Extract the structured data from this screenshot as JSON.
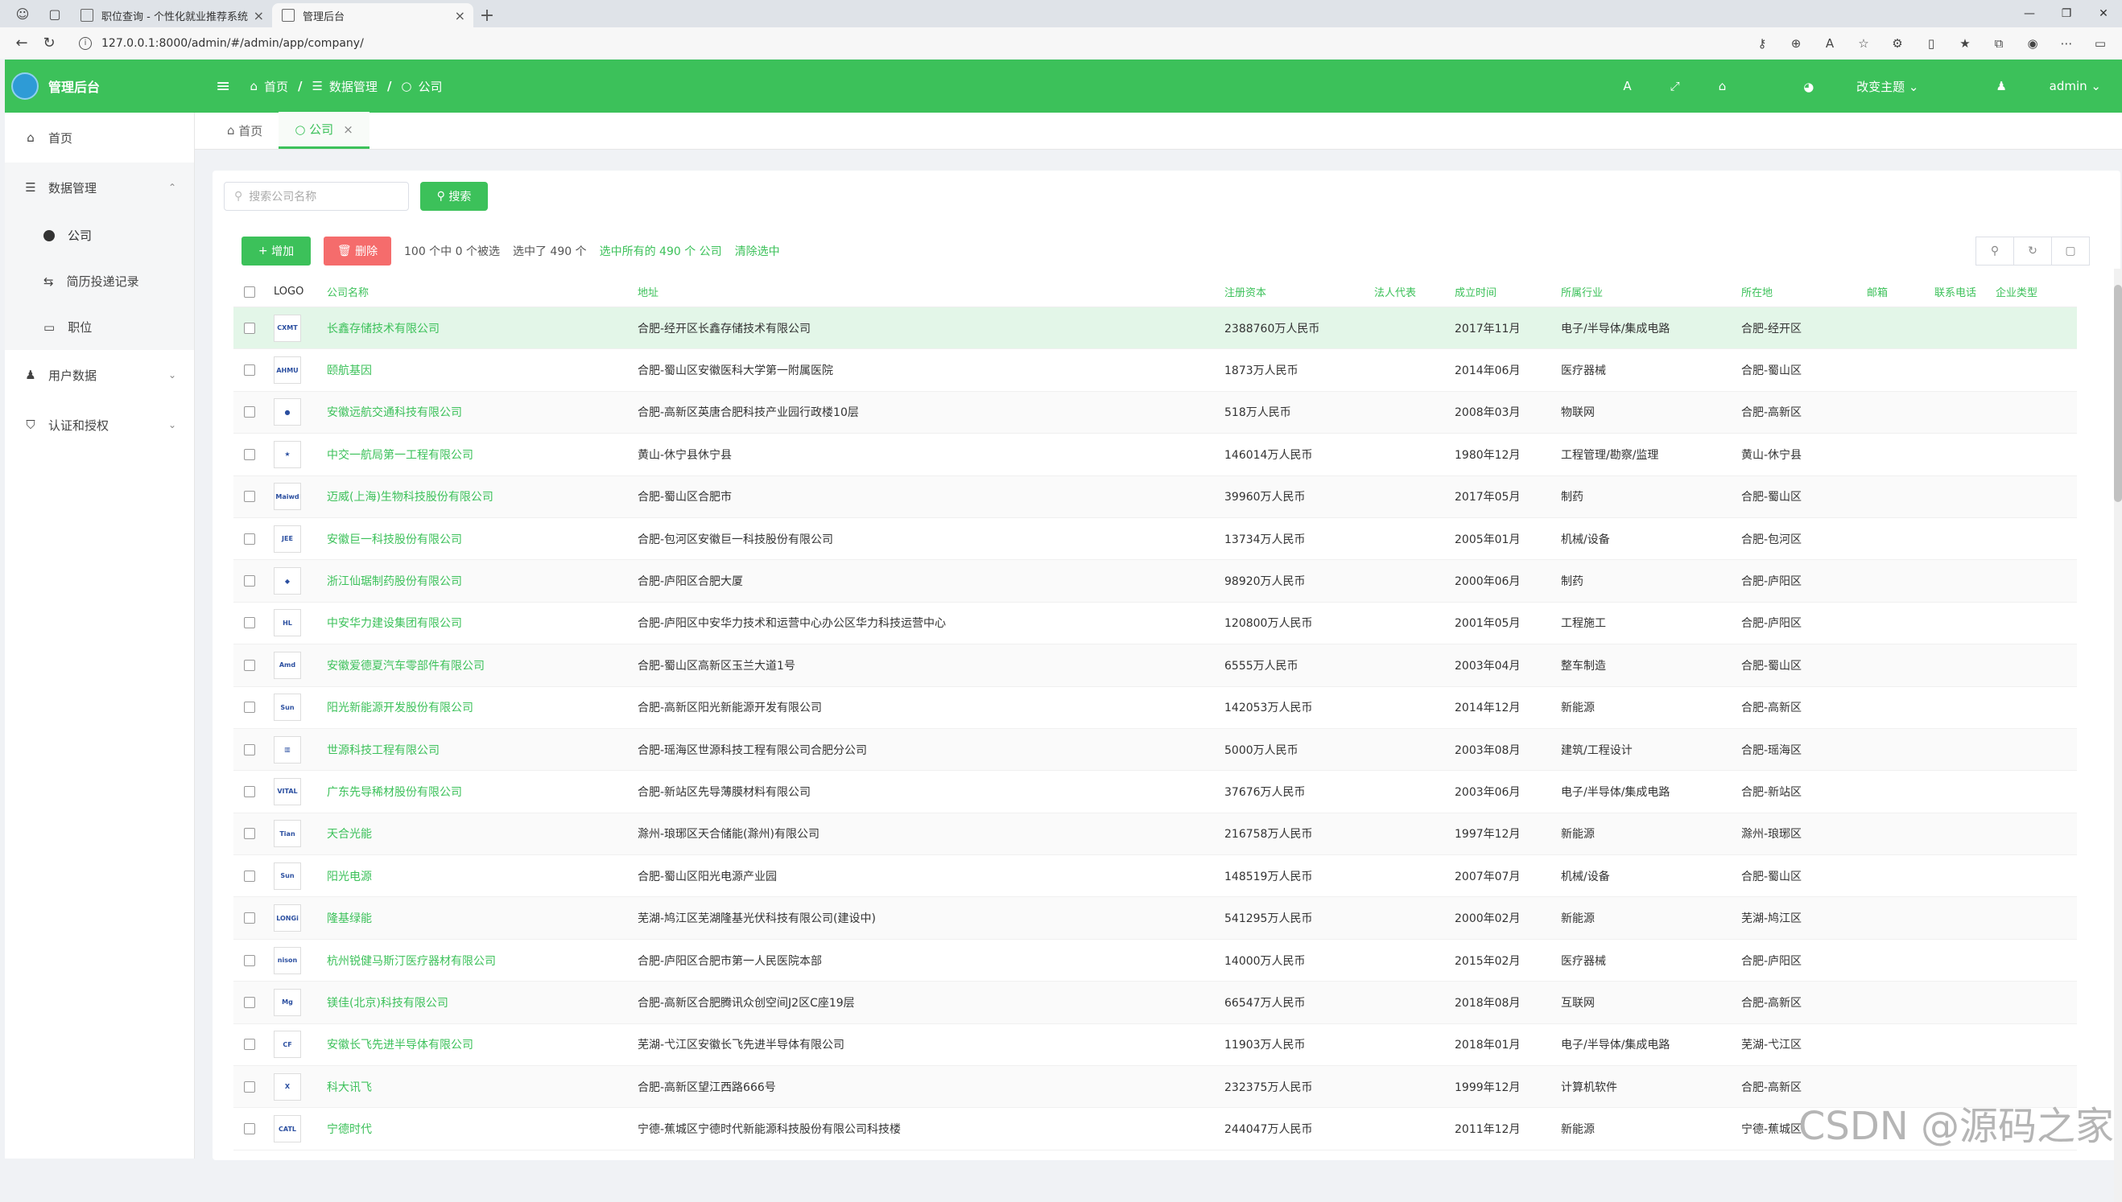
{
  "browser": {
    "tabs": [
      {
        "label": "职位查询 - 个性化就业推荐系统"
      },
      {
        "label": "管理后台"
      }
    ],
    "url": "127.0.0.1:8000/admin/#/admin/app/company/"
  },
  "header": {
    "title": "管理后台",
    "breadcrumb": [
      "首页",
      "数据管理",
      "公司"
    ],
    "theme_label": "改变主题",
    "user_label": "admin"
  },
  "sidebar": {
    "home": "首页",
    "data_group": "数据管理",
    "sub_items": [
      "公司",
      "简历投递记录",
      "职位"
    ],
    "user_data": "用户数据",
    "auth": "认证和授权"
  },
  "tabs": {
    "home": "首页",
    "company": "公司"
  },
  "search": {
    "placeholder": "搜索公司名称",
    "button": "搜索"
  },
  "actions": {
    "add": "增加",
    "delete": "删除",
    "info1": "100 个中 0 个被选",
    "info2": "选中了 490 个",
    "select_all": "选中所有的 490 个 公司",
    "clear": "清除选中"
  },
  "columns": [
    "LOGO",
    "公司名称",
    "地址",
    "注册资本",
    "法人代表",
    "成立时间",
    "所属行业",
    "所在地",
    "邮箱",
    "联系电话",
    "企业类型"
  ],
  "rows": [
    {
      "logo": "CXMT",
      "name": "长鑫存储技术有限公司",
      "addr": "合肥-经开区长鑫存储技术有限公司",
      "cap": "2388760万人民币",
      "date": "2017年11月",
      "ind": "电子/半导体/集成电路",
      "loc": "合肥-经开区"
    },
    {
      "logo": "AHMU",
      "name": "颐航基因",
      "addr": "合肥-蜀山区安徽医科大学第一附属医院",
      "cap": "1873万人民币",
      "date": "2014年06月",
      "ind": "医疗器械",
      "loc": "合肥-蜀山区"
    },
    {
      "logo": "●",
      "name": "安徽远航交通科技有限公司",
      "addr": "合肥-高新区英唐合肥科技产业园行政楼10层",
      "cap": "518万人民币",
      "date": "2008年03月",
      "ind": "物联网",
      "loc": "合肥-高新区"
    },
    {
      "logo": "★",
      "name": "中交一航局第一工程有限公司",
      "addr": "黄山-休宁县休宁县",
      "cap": "146014万人民币",
      "date": "1980年12月",
      "ind": "工程管理/勘察/监理",
      "loc": "黄山-休宁县"
    },
    {
      "logo": "Maiwd",
      "name": "迈威(上海)生物科技股份有限公司",
      "addr": "合肥-蜀山区合肥市",
      "cap": "39960万人民币",
      "date": "2017年05月",
      "ind": "制药",
      "loc": "合肥-蜀山区"
    },
    {
      "logo": "JEE",
      "name": "安徽巨一科技股份有限公司",
      "addr": "合肥-包河区安徽巨一科技股份有限公司",
      "cap": "13734万人民币",
      "date": "2005年01月",
      "ind": "机械/设备",
      "loc": "合肥-包河区"
    },
    {
      "logo": "◆",
      "name": "浙江仙琚制药股份有限公司",
      "addr": "合肥-庐阳区合肥大厦",
      "cap": "98920万人民币",
      "date": "2000年06月",
      "ind": "制药",
      "loc": "合肥-庐阳区"
    },
    {
      "logo": "HL",
      "name": "中安华力建设集团有限公司",
      "addr": "合肥-庐阳区中安华力技术和运营中心办公区华力科技运营中心",
      "cap": "120800万人民币",
      "date": "2001年05月",
      "ind": "工程施工",
      "loc": "合肥-庐阳区"
    },
    {
      "logo": "Amd",
      "name": "安徽爱德夏汽车零部件有限公司",
      "addr": "合肥-蜀山区高新区玉兰大道1号",
      "cap": "6555万人民币",
      "date": "2003年04月",
      "ind": "整车制造",
      "loc": "合肥-蜀山区"
    },
    {
      "logo": "Sun",
      "name": "阳光新能源开发股份有限公司",
      "addr": "合肥-高新区阳光新能源开发有限公司",
      "cap": "142053万人民币",
      "date": "2014年12月",
      "ind": "新能源",
      "loc": "合肥-高新区"
    },
    {
      "logo": "▥",
      "name": "世源科技工程有限公司",
      "addr": "合肥-瑶海区世源科技工程有限公司合肥分公司",
      "cap": "5000万人民币",
      "date": "2003年08月",
      "ind": "建筑/工程设计",
      "loc": "合肥-瑶海区"
    },
    {
      "logo": "VITAL",
      "name": "广东先导稀材股份有限公司",
      "addr": "合肥-新站区先导薄膜材料有限公司",
      "cap": "37676万人民币",
      "date": "2003年06月",
      "ind": "电子/半导体/集成电路",
      "loc": "合肥-新站区"
    },
    {
      "logo": "Tian",
      "name": "天合光能",
      "addr": "滁州-琅琊区天合储能(滁州)有限公司",
      "cap": "216758万人民币",
      "date": "1997年12月",
      "ind": "新能源",
      "loc": "滁州-琅琊区"
    },
    {
      "logo": "Sun",
      "name": "阳光电源",
      "addr": "合肥-蜀山区阳光电源产业园",
      "cap": "148519万人民币",
      "date": "2007年07月",
      "ind": "机械/设备",
      "loc": "合肥-蜀山区"
    },
    {
      "logo": "LONGi",
      "name": "隆基绿能",
      "addr": "芜湖-鸠江区芜湖隆基光伏科技有限公司(建设中)",
      "cap": "541295万人民币",
      "date": "2000年02月",
      "ind": "新能源",
      "loc": "芜湖-鸠江区"
    },
    {
      "logo": "nison",
      "name": "杭州锐健马斯汀医疗器材有限公司",
      "addr": "合肥-庐阳区合肥市第一人民医院本部",
      "cap": "14000万人民币",
      "date": "2015年02月",
      "ind": "医疗器械",
      "loc": "合肥-庐阳区"
    },
    {
      "logo": "Mg",
      "name": "镁佳(北京)科技有限公司",
      "addr": "合肥-高新区合肥腾讯众创空间J2区C座19层",
      "cap": "66547万人民币",
      "date": "2018年08月",
      "ind": "互联网",
      "loc": "合肥-高新区"
    },
    {
      "logo": "CF",
      "name": "安徽长飞先进半导体有限公司",
      "addr": "芜湖-弋江区安徽长飞先进半导体有限公司",
      "cap": "11903万人民币",
      "date": "2018年01月",
      "ind": "电子/半导体/集成电路",
      "loc": "芜湖-弋江区"
    },
    {
      "logo": "X",
      "name": "科大讯飞",
      "addr": "合肥-高新区望江西路666号",
      "cap": "232375万人民币",
      "date": "1999年12月",
      "ind": "计算机软件",
      "loc": "合肥-高新区"
    },
    {
      "logo": "CATL",
      "name": "宁德时代",
      "addr": "宁德-蕉城区宁德时代新能源科技股份有限公司科技楼",
      "cap": "244047万人民币",
      "date": "2011年12月",
      "ind": "新能源",
      "loc": "宁德-蕉城区"
    }
  ],
  "watermark": "CSDN @源码之家"
}
